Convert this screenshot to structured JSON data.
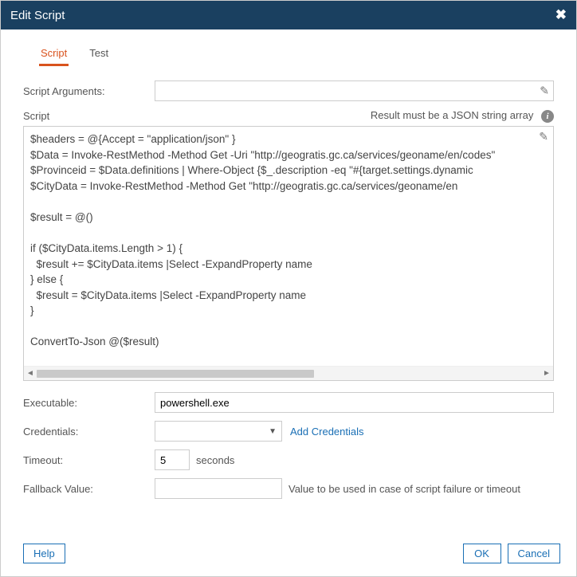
{
  "dialog": {
    "title": "Edit Script"
  },
  "tabs": {
    "script": "Script",
    "test": "Test",
    "active": "script"
  },
  "labels": {
    "script_arguments": "Script Arguments:",
    "script": "Script",
    "result_note": "Result must be a JSON string array",
    "executable": "Executable:",
    "credentials": "Credentials:",
    "add_credentials": "Add Credentials",
    "timeout": "Timeout:",
    "seconds": "seconds",
    "fallback_value": "Fallback Value:",
    "fallback_hint": "Value to be used in case of script failure or timeout"
  },
  "values": {
    "script_arguments": "",
    "script_body": "$headers = @{Accept = \"application/json\" }\n$Data = Invoke-RestMethod -Method Get -Uri \"http://geogratis.gc.ca/services/geoname/en/codes\"\n$Provinceid = $Data.definitions | Where-Object {$_.description -eq \"#{target.settings.dynamic\n$CityData = Invoke-RestMethod -Method Get \"http://geogratis.gc.ca/services/geoname/en\n\n$result = @()\n\nif ($CityData.items.Length > 1) {\n  $result += $CityData.items |Select -ExpandProperty name\n} else {\n  $result = $CityData.items |Select -ExpandProperty name\n}\n\nConvertTo-Json @($result)",
    "executable": "powershell.exe",
    "credentials_selected": "",
    "timeout": "5",
    "fallback_value": ""
  },
  "buttons": {
    "help": "Help",
    "ok": "OK",
    "cancel": "Cancel"
  }
}
